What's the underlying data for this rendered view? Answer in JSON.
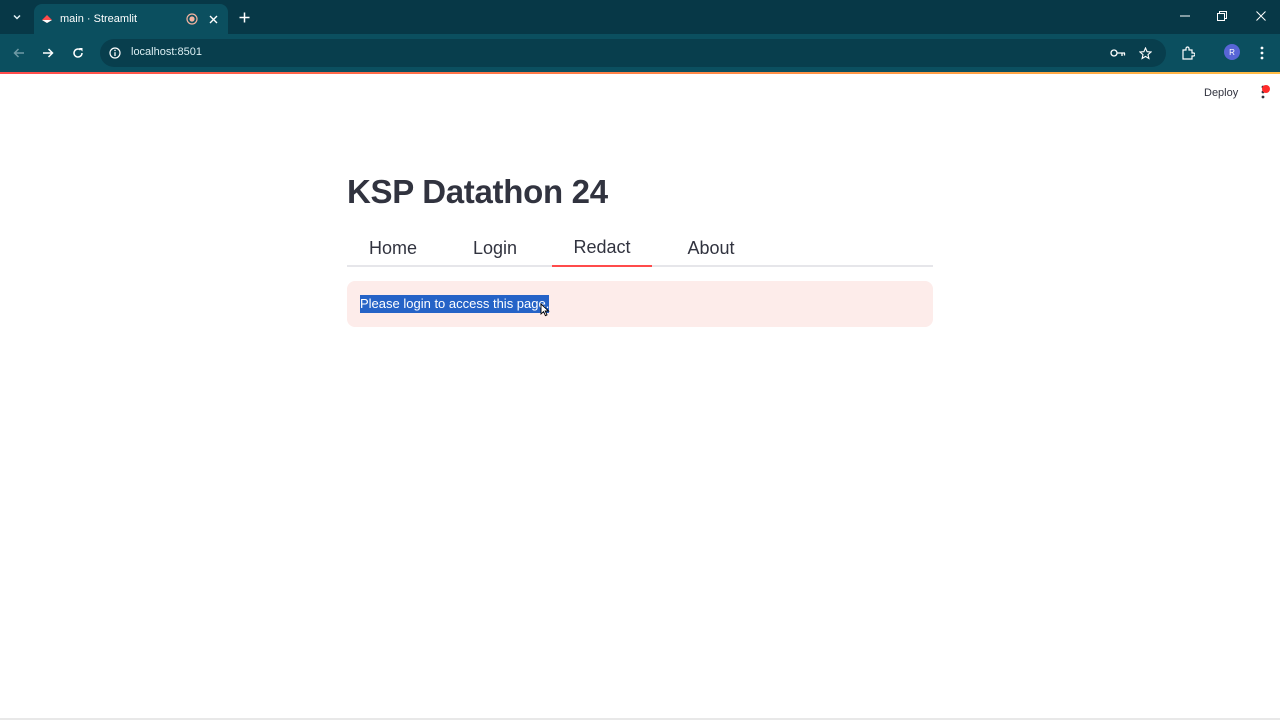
{
  "browser": {
    "tab_title": "main · Streamlit",
    "url": "localhost:8501",
    "avatar_letter": "R",
    "colors": {
      "chrome_dark": "#073847",
      "chrome": "#0b4f5f"
    }
  },
  "app": {
    "header": {
      "deploy_label": "Deploy"
    },
    "title": "KSP Datathon 24",
    "tabs": [
      {
        "label": "Home",
        "active": false
      },
      {
        "label": "Login",
        "active": false
      },
      {
        "label": "Redact",
        "active": true
      },
      {
        "label": "About",
        "active": false
      }
    ],
    "alert": {
      "type": "error",
      "message": "Please login to access this page."
    },
    "colors": {
      "accent": "#ff4b4b",
      "alert_bg": "#fdecea",
      "text": "#31333f",
      "selection": "#2563c7"
    }
  }
}
